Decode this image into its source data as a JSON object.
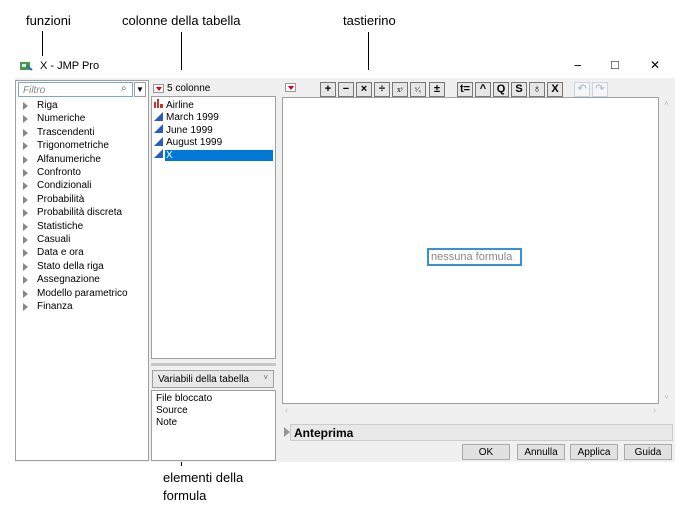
{
  "callouts": {
    "functions": "funzioni",
    "columns": "colonne della tabella",
    "keypad": "tastierino",
    "formula_elements_1": "elementi della",
    "formula_elements_2": "formula"
  },
  "window": {
    "title": "X - JMP Pro",
    "controls": {
      "minimize": "−",
      "maximize": "□",
      "close": "✕"
    }
  },
  "functions": {
    "filter_placeholder": "Filtro",
    "items": [
      "Riga",
      "Numeriche",
      "Trascendenti",
      "Trigonometriche",
      "Alfanumeriche",
      "Confronto",
      "Condizionali",
      "Probabilità",
      "Probabilità discreta",
      "Statistiche",
      "Casuali",
      "Data e ora",
      "Stato della riga",
      "Assegnazione",
      "Modello parametrico",
      "Finanza"
    ]
  },
  "columns": {
    "header": "5 colonne",
    "items": [
      {
        "name": "Airline",
        "type": "nominal"
      },
      {
        "name": "March 1999",
        "type": "continuous"
      },
      {
        "name": "June 1999",
        "type": "continuous"
      },
      {
        "name": "August 1999",
        "type": "continuous"
      },
      {
        "name": "X",
        "type": "continuous",
        "selected": true
      }
    ]
  },
  "elements": {
    "dropdown": "Variabili della tabella",
    "items": [
      "File bloccato",
      "Source",
      "Note"
    ]
  },
  "keypad": {
    "buttons": [
      "+",
      "−",
      "×",
      "÷",
      "xʸ",
      "ʸ⁄ₓ",
      "±",
      "t=",
      "^",
      "Q",
      "S",
      "♁",
      "X"
    ],
    "undo": "↶",
    "redo": "↷"
  },
  "editor": {
    "placeholder": "nessuna formula"
  },
  "preview": {
    "label": "Anteprima"
  },
  "actions": {
    "ok": "OK",
    "cancel": "Annulla",
    "apply": "Applica",
    "help": "Guida"
  },
  "colors": {
    "selection": "#0078d7",
    "formula_border": "#3c8fd6",
    "nominal": "#c0392b",
    "continuous": "#2a5bbf"
  }
}
